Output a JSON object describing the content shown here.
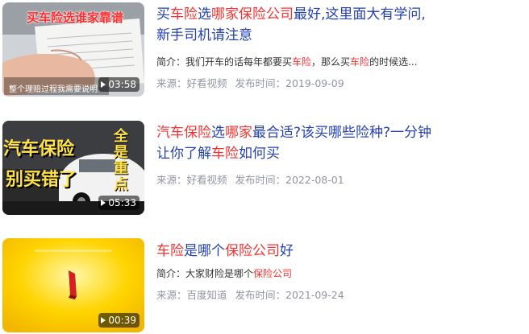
{
  "results": [
    {
      "title_parts": [
        {
          "text": "买",
          "hl": false
        },
        {
          "text": "车险",
          "hl": true
        },
        {
          "text": "选",
          "hl": false
        },
        {
          "text": "哪家保险公司",
          "hl": true
        },
        {
          "text": "最好,这里面大有学问,",
          "hl": false
        },
        {
          "text": "新手司机请注意",
          "hl": false
        }
      ],
      "snippet_parts": [
        {
          "text": "简介：我们开车的话每年都要买",
          "hl": false
        },
        {
          "text": "车险",
          "hl": true
        },
        {
          "text": "，那么买",
          "hl": false
        },
        {
          "text": "车险",
          "hl": true
        },
        {
          "text": "的时候选...",
          "hl": false
        }
      ],
      "source_label": "来源：好看视频",
      "date_label": "发布时间：2019-09-09",
      "duration": "03:58",
      "thumb_caption_top": "买车险选谁家靠谱",
      "thumb_caption_bottom": "整个理赔过程我需要说明"
    },
    {
      "title_parts": [
        {
          "text": "汽车保险",
          "hl": true
        },
        {
          "text": "选",
          "hl": false
        },
        {
          "text": "哪家",
          "hl": true
        },
        {
          "text": "最合适?该买哪些险种?一分钟",
          "hl": false
        },
        {
          "text": "让你了解",
          "hl": false
        },
        {
          "text": "车险",
          "hl": true
        },
        {
          "text": "如何买",
          "hl": false
        }
      ],
      "source_label": "来源：好看视频",
      "date_label": "发布时间：2022-08-01",
      "duration": "05:33",
      "thumb_caption_line1": "汽车保险",
      "thumb_caption_line2": "别买错了",
      "thumb_caption_side": "全是重点"
    },
    {
      "title_parts": [
        {
          "text": "车险",
          "hl": true
        },
        {
          "text": "是哪个",
          "hl": false
        },
        {
          "text": "保险公司",
          "hl": true
        },
        {
          "text": "好",
          "hl": false
        }
      ],
      "snippet_parts": [
        {
          "text": "简介：大家财险是哪个",
          "hl": false
        },
        {
          "text": "保险公司",
          "hl": true
        }
      ],
      "source_label": "来源：百度知道",
      "date_label": "发布时间：2021-09-24",
      "duration": "00:39"
    }
  ]
}
